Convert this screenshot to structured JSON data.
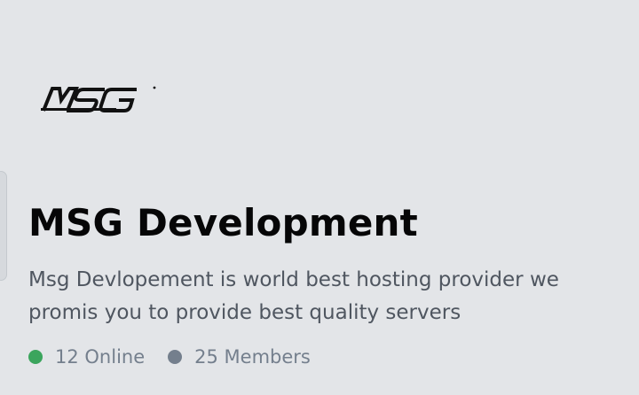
{
  "server": {
    "logo_text": "MSG",
    "name": "MSG Development",
    "description": "Msg Devlopement is world best hosting provider we promis you to provide best quality servers"
  },
  "stats": {
    "online": {
      "label": "12 Online",
      "color": "#3ba55d"
    },
    "members": {
      "label": "25 Members",
      "color": "#747f8d"
    }
  },
  "colors": {
    "background": "#e3e5e8",
    "title": "#060607",
    "description": "#4f5660"
  }
}
